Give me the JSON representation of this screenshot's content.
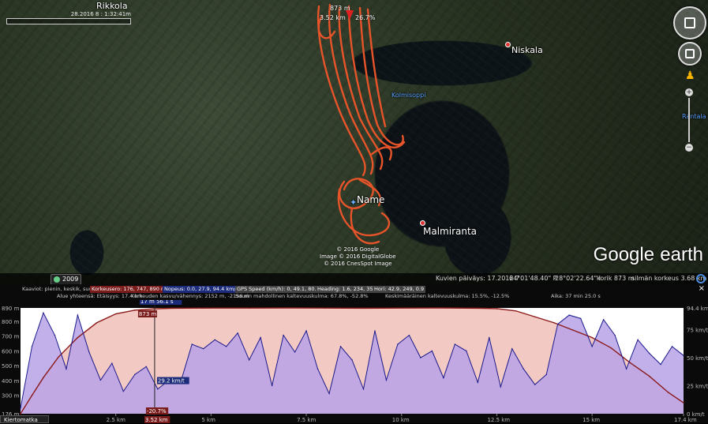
{
  "map": {
    "places": [
      {
        "name": "Rikkola"
      },
      {
        "name": "Niskala"
      },
      {
        "name": "Kolmisoppi"
      },
      {
        "name": "Name"
      },
      {
        "name": "Malmiranta"
      },
      {
        "name": "Rantala"
      }
    ],
    "scale_text": "28.2016 8 : 1:32:41m",
    "cursor": {
      "altitude": "873 m",
      "distance": "3.52 km",
      "grade": "26.7%"
    },
    "copyright": [
      "© 2016 Google",
      "Image © 2016 DigitalGlobe",
      "© 2016 CnesSpot Image"
    ],
    "logo": {
      "brand": "Google",
      "suffix": "earth"
    },
    "year_badge": "2009"
  },
  "statusbar": {
    "imagery_date": "Kuvien päiväys: 17.2012 7",
    "lat": "64°01'48.40\" P",
    "lon": "28°02'22.64\" I",
    "elev": "korik  873 m",
    "eye_alt": "silmän korkeus   3.68 km"
  },
  "stats": {
    "row1": [
      {
        "text": "Kaaviot: pienin, keskik, suurin",
        "style": ""
      },
      {
        "text": "Korkeusero: 176, 747, 890 m",
        "style": "hl-red"
      },
      {
        "text": "Nopeus: 0.0, 27.9, 94.4 km/t",
        "style": "hl-blue"
      },
      {
        "text": "GPS Speed (km/h): 0, 49.1, 80.4",
        "style": "hl-grey"
      },
      {
        "text": "Heading: 1.6, 234, 358",
        "style": "hl-grey"
      },
      {
        "text": "Hori: 42.9, 249, 0.9",
        "style": "hl-grey"
      }
    ],
    "row2": [
      {
        "text": "Alue yhteensä:  Etäisyys: 17.4 km",
        "style": ""
      },
      {
        "text": "Korkeuden kasvu/vähennys: 2152 m, -2156 m",
        "style": ""
      },
      {
        "text": "Suurin mahdollinen kaltevuuskulma: 67.8%, -52.8%",
        "style": ""
      },
      {
        "text": "Keskimääräinen kaltevuuskulma: 15.5%, -12.5%",
        "style": ""
      },
      {
        "text": "Aika: 37 min 25.0 s",
        "style": ""
      }
    ],
    "close": "×"
  },
  "profile_button": "Kiertomatka",
  "colors": {
    "elevation_fill": "#f3c9c4",
    "speed_fill": "#b7a2e8",
    "elevation_line": "#8a1a1a",
    "speed_line": "#1a1a8a",
    "track": "#e8542a"
  },
  "chart_data": {
    "type": "area",
    "x_unit": "km",
    "x_range": [
      0,
      17.4
    ],
    "x_ticks": [
      "2.5 km",
      "5 km",
      "7.5 km",
      "10 km",
      "12.5 km",
      "15 km",
      "17.4 km"
    ],
    "x_tick_values": [
      2.5,
      5,
      7.5,
      10,
      12.5,
      15,
      17.4
    ],
    "y_left_ticks": [
      "890 m",
      "800 m",
      "700 m",
      "600 m",
      "500 m",
      "400 m",
      "300 m",
      "176 m"
    ],
    "y_left_values": [
      890,
      800,
      700,
      600,
      500,
      400,
      300,
      176
    ],
    "y_left_range": [
      176,
      890
    ],
    "y_right_ticks": [
      "94.4 km/t",
      "75 km/t",
      "50 km/t",
      "25 km/t",
      "0 km/t"
    ],
    "y_right_values": [
      94.4,
      75,
      50,
      25,
      0
    ],
    "y_right_range": [
      0,
      94.4
    ],
    "cursor": {
      "x": 3.52,
      "top_label": "17 m  56.1 s",
      "alt_label": "873 m",
      "speed_label": "29.2 km/t",
      "bottom_label": "3.52 km",
      "grade_label": "-20.7%"
    },
    "series": [
      {
        "name": "Korkeusero",
        "x": [
          0,
          0.3,
          0.6,
          1.0,
          1.5,
          2.0,
          2.5,
          3.0,
          3.5,
          4.0,
          5.0,
          6.0,
          7.0,
          8.0,
          9.0,
          10.0,
          11.0,
          12.0,
          12.5,
          13.0,
          13.5,
          14.0,
          14.5,
          15.0,
          15.5,
          16.0,
          16.5,
          17.0,
          17.4
        ],
        "values": [
          176,
          300,
          420,
          560,
          690,
          790,
          850,
          875,
          884,
          888,
          889,
          889,
          890,
          889,
          888,
          889,
          890,
          888,
          885,
          870,
          830,
          790,
          740,
          690,
          620,
          520,
          430,
          320,
          250
        ]
      },
      {
        "name": "Nopeus",
        "x": [
          0,
          0.3,
          0.6,
          0.9,
          1.2,
          1.5,
          1.8,
          2.1,
          2.4,
          2.7,
          3.0,
          3.3,
          3.6,
          3.9,
          4.2,
          4.5,
          4.8,
          5.1,
          5.4,
          5.7,
          6.0,
          6.3,
          6.6,
          6.9,
          7.2,
          7.5,
          7.8,
          8.1,
          8.4,
          8.7,
          9.0,
          9.3,
          9.6,
          9.9,
          10.2,
          10.5,
          10.8,
          11.1,
          11.4,
          11.7,
          12.0,
          12.3,
          12.6,
          12.9,
          13.2,
          13.5,
          13.8,
          14.1,
          14.4,
          14.7,
          15.0,
          15.3,
          15.6,
          15.9,
          16.2,
          16.5,
          16.8,
          17.1,
          17.4
        ],
        "values": [
          5,
          60,
          90,
          70,
          40,
          88,
          55,
          30,
          45,
          20,
          35,
          42,
          22,
          30,
          28,
          62,
          58,
          66,
          60,
          72,
          48,
          68,
          25,
          70,
          55,
          74,
          40,
          18,
          60,
          48,
          22,
          74,
          30,
          62,
          70,
          50,
          56,
          32,
          62,
          56,
          28,
          68,
          24,
          58,
          40,
          26,
          35,
          80,
          88,
          85,
          60,
          84,
          70,
          40,
          66,
          54,
          44,
          60,
          52
        ]
      }
    ]
  }
}
